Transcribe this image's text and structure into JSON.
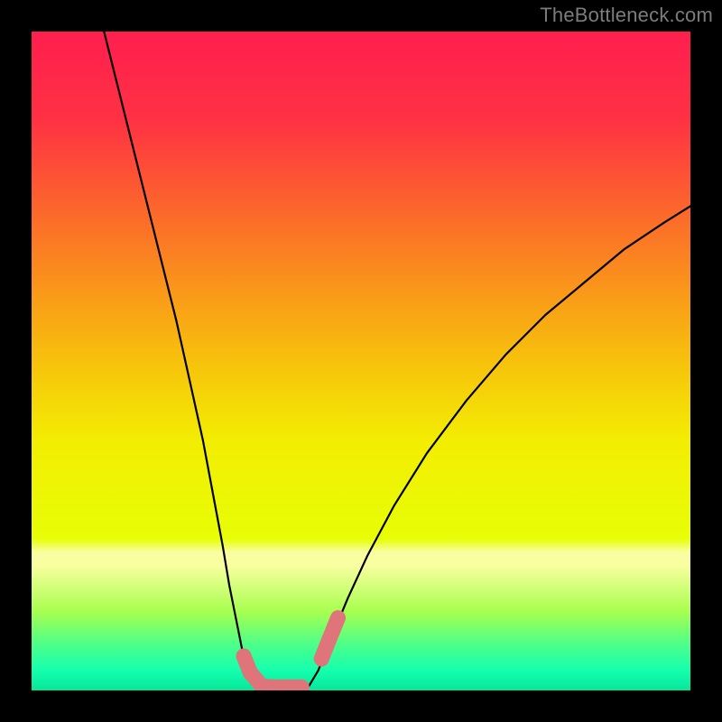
{
  "watermark": "TheBottleneck.com",
  "chart_data": {
    "type": "line",
    "title": "",
    "xlabel": "",
    "ylabel": "",
    "xlim": [
      0,
      100
    ],
    "ylim": [
      0,
      100
    ],
    "gradient_stops": [
      {
        "offset": 0.0,
        "color": "#ff1f4e"
      },
      {
        "offset": 0.13,
        "color": "#ff3044"
      },
      {
        "offset": 0.28,
        "color": "#fc6a2a"
      },
      {
        "offset": 0.47,
        "color": "#f8b60f"
      },
      {
        "offset": 0.62,
        "color": "#f3ed02"
      },
      {
        "offset": 0.77,
        "color": "#e7fe06"
      },
      {
        "offset": 0.79,
        "color": "#f9ffa0"
      },
      {
        "offset": 0.81,
        "color": "#f9ffa0"
      },
      {
        "offset": 0.88,
        "color": "#a8ff4f"
      },
      {
        "offset": 0.93,
        "color": "#4dff89"
      },
      {
        "offset": 0.97,
        "color": "#14ffae"
      },
      {
        "offset": 1.0,
        "color": "#05e79a"
      }
    ],
    "series": [
      {
        "name": "left-curve",
        "points": [
          {
            "x": 11.0,
            "y": 100.0
          },
          {
            "x": 12.5,
            "y": 94.0
          },
          {
            "x": 14.5,
            "y": 86.0
          },
          {
            "x": 17.0,
            "y": 76.0
          },
          {
            "x": 19.5,
            "y": 66.0
          },
          {
            "x": 22.0,
            "y": 56.0
          },
          {
            "x": 24.0,
            "y": 47.0
          },
          {
            "x": 26.0,
            "y": 38.0
          },
          {
            "x": 27.5,
            "y": 30.0
          },
          {
            "x": 29.0,
            "y": 22.0
          },
          {
            "x": 30.0,
            "y": 16.0
          },
          {
            "x": 31.0,
            "y": 11.0
          },
          {
            "x": 32.0,
            "y": 6.0
          },
          {
            "x": 33.0,
            "y": 2.5
          },
          {
            "x": 34.5,
            "y": 0.5
          }
        ]
      },
      {
        "name": "floor",
        "points": [
          {
            "x": 34.5,
            "y": 0.5
          },
          {
            "x": 42.0,
            "y": 0.5
          }
        ]
      },
      {
        "name": "right-curve",
        "points": [
          {
            "x": 42.0,
            "y": 0.5
          },
          {
            "x": 43.5,
            "y": 3.0
          },
          {
            "x": 45.5,
            "y": 8.0
          },
          {
            "x": 48.0,
            "y": 14.0
          },
          {
            "x": 51.0,
            "y": 20.5
          },
          {
            "x": 55.0,
            "y": 28.0
          },
          {
            "x": 60.0,
            "y": 36.0
          },
          {
            "x": 66.0,
            "y": 44.0
          },
          {
            "x": 72.0,
            "y": 51.0
          },
          {
            "x": 78.0,
            "y": 57.0
          },
          {
            "x": 84.0,
            "y": 62.0
          },
          {
            "x": 90.0,
            "y": 67.0
          },
          {
            "x": 96.0,
            "y": 71.0
          },
          {
            "x": 100.0,
            "y": 73.5
          }
        ]
      }
    ],
    "markers": [
      {
        "x": 32.2,
        "y": 5.2
      },
      {
        "x": 33.2,
        "y": 2.7
      },
      {
        "x": 35.0,
        "y": 0.6
      },
      {
        "x": 37.0,
        "y": 0.5
      },
      {
        "x": 39.0,
        "y": 0.5
      },
      {
        "x": 41.0,
        "y": 0.5
      },
      {
        "x": 44.0,
        "y": 4.8
      },
      {
        "x": 45.2,
        "y": 7.8
      },
      {
        "x": 46.5,
        "y": 11.0
      }
    ],
    "marker_color": "#e0747b",
    "curve_color": "#000000",
    "curve_width": 2.2
  }
}
